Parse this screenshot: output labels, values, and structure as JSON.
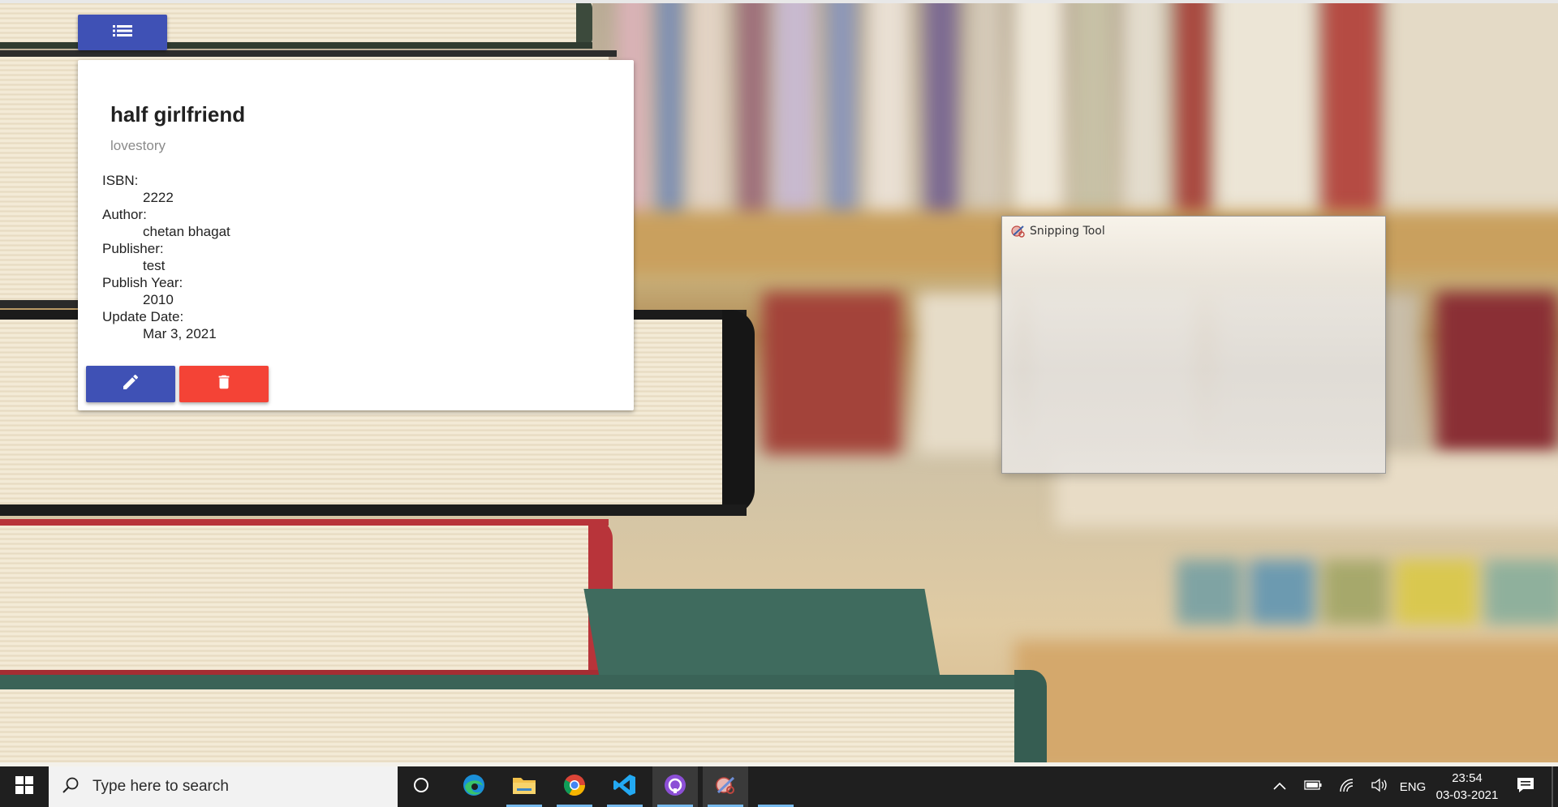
{
  "app": {
    "menu_button_icon": "list-icon",
    "accent": "#3f51b5",
    "danger": "#f44336"
  },
  "book": {
    "title": "half girlfriend",
    "category": "lovestory",
    "fields": [
      {
        "label": "ISBN:",
        "value": "2222"
      },
      {
        "label": "Author:",
        "value": "chetan bhagat"
      },
      {
        "label": "Publisher:",
        "value": "test"
      },
      {
        "label": "Publish Year:",
        "value": "2010"
      },
      {
        "label": "Update Date:",
        "value": "Mar 3, 2021"
      }
    ],
    "edit_icon": "pencil-icon",
    "delete_icon": "trash-icon"
  },
  "snipping_tool": {
    "title": "Snipping Tool",
    "icon": "scissors-icon"
  },
  "taskbar": {
    "search_placeholder": "Type here to search",
    "apps": [
      "task-view",
      "edge",
      "file-explorer",
      "chrome",
      "vscode",
      "github-desktop",
      "snipping-tool"
    ],
    "tray": {
      "language": "ENG",
      "time": "23:54",
      "date": "03-03-2021"
    }
  }
}
